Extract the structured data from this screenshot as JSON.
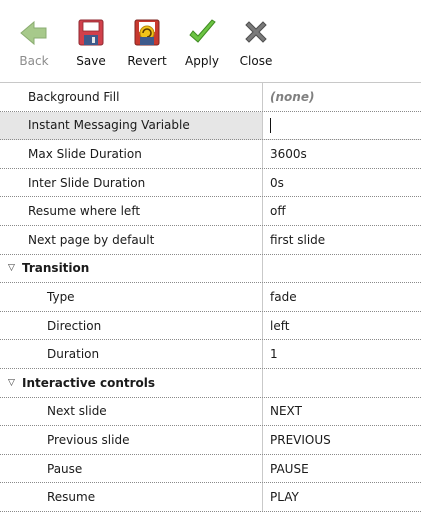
{
  "toolbar": {
    "back_label": "Back",
    "save_label": "Save",
    "revert_label": "Revert",
    "apply_label": "Apply",
    "close_label": "Close"
  },
  "properties": {
    "background_fill": {
      "label": "Background Fill",
      "value": "(none)"
    },
    "instant_messaging_variable": {
      "label": "Instant Messaging Variable",
      "value": ""
    },
    "max_slide_duration": {
      "label": "Max Slide Duration",
      "value": "3600s"
    },
    "inter_slide_duration": {
      "label": "Inter Slide Duration",
      "value": "0s"
    },
    "resume_where_left": {
      "label": "Resume where left",
      "value": "off"
    },
    "next_page_by_default": {
      "label": "Next page by default",
      "value": "first slide"
    }
  },
  "transition": {
    "title": "Transition",
    "type": {
      "label": "Type",
      "value": "fade"
    },
    "direction": {
      "label": "Direction",
      "value": "left"
    },
    "duration": {
      "label": "Duration",
      "value": "1"
    }
  },
  "interactive_controls": {
    "title": "Interactive controls",
    "next_slide": {
      "label": "Next slide",
      "value": "NEXT"
    },
    "previous_slide": {
      "label": "Previous slide",
      "value": "PREVIOUS"
    },
    "pause": {
      "label": "Pause",
      "value": "PAUSE"
    },
    "resume": {
      "label": "Resume",
      "value": "PLAY"
    }
  },
  "colors": {
    "save_icon": "#d1404b",
    "apply_icon": "#6cc443",
    "back_icon": "#a7c98b",
    "close_icon": "#6d6d6d"
  }
}
